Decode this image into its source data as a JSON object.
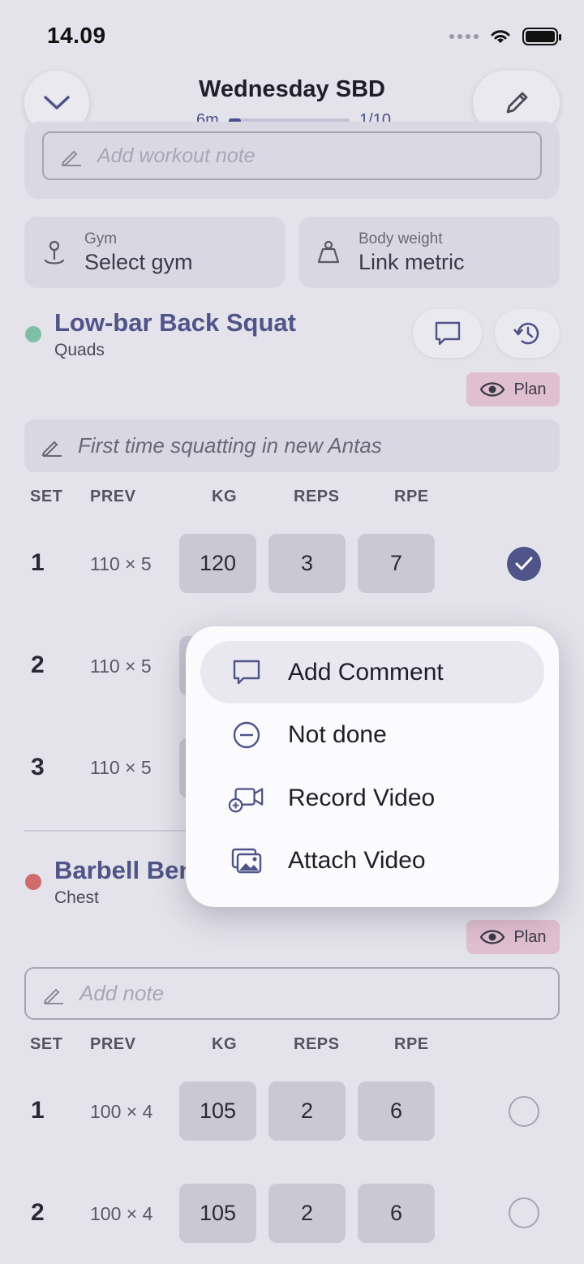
{
  "status": {
    "time": "14.09"
  },
  "header": {
    "title": "Wednesday SBD",
    "elapsed": "6m",
    "progress_text": "1/10",
    "progress": 0.1
  },
  "workout_note_placeholder": "Add workout note",
  "gym": {
    "label": "Gym",
    "value": "Select gym"
  },
  "body_weight": {
    "label": "Body weight",
    "value": "Link metric"
  },
  "columns": {
    "set": "SET",
    "prev": "PREV",
    "kg": "KG",
    "reps": "REPS",
    "rpe": "RPE"
  },
  "exercises": [
    {
      "name": "Low-bar Back Squat",
      "muscle": "Quads",
      "color": "#7fbfa6",
      "plan_label": "Plan",
      "note": "First time squatting in new Antas",
      "sets": [
        {
          "num": "1",
          "prev": "110 × 5",
          "kg": "120",
          "reps": "3",
          "rpe": "7",
          "done": true
        },
        {
          "num": "2",
          "prev": "110 × 5",
          "done": false
        },
        {
          "num": "3",
          "prev": "110 × 5",
          "done": false
        }
      ]
    },
    {
      "name": "Barbell Ben",
      "muscle": "Chest",
      "color": "#d06b6b",
      "plan_label": "Plan",
      "note_placeholder": "Add note",
      "sets": [
        {
          "num": "1",
          "prev": "100 × 4",
          "kg": "105",
          "reps": "2",
          "rpe": "6",
          "done": false
        },
        {
          "num": "2",
          "prev": "100 × 4",
          "kg": "105",
          "reps": "2",
          "rpe": "6",
          "done": false
        }
      ]
    }
  ],
  "menu": {
    "items": [
      {
        "label": "Add Comment",
        "icon": "comment-icon"
      },
      {
        "label": "Not done",
        "icon": "minus-circle-icon"
      },
      {
        "label": "Record Video",
        "icon": "video-add-icon"
      },
      {
        "label": "Attach Video",
        "icon": "photo-stack-icon"
      }
    ]
  },
  "colors": {
    "accent": "#4f5489",
    "plan_bg": "#e0bfd0"
  }
}
